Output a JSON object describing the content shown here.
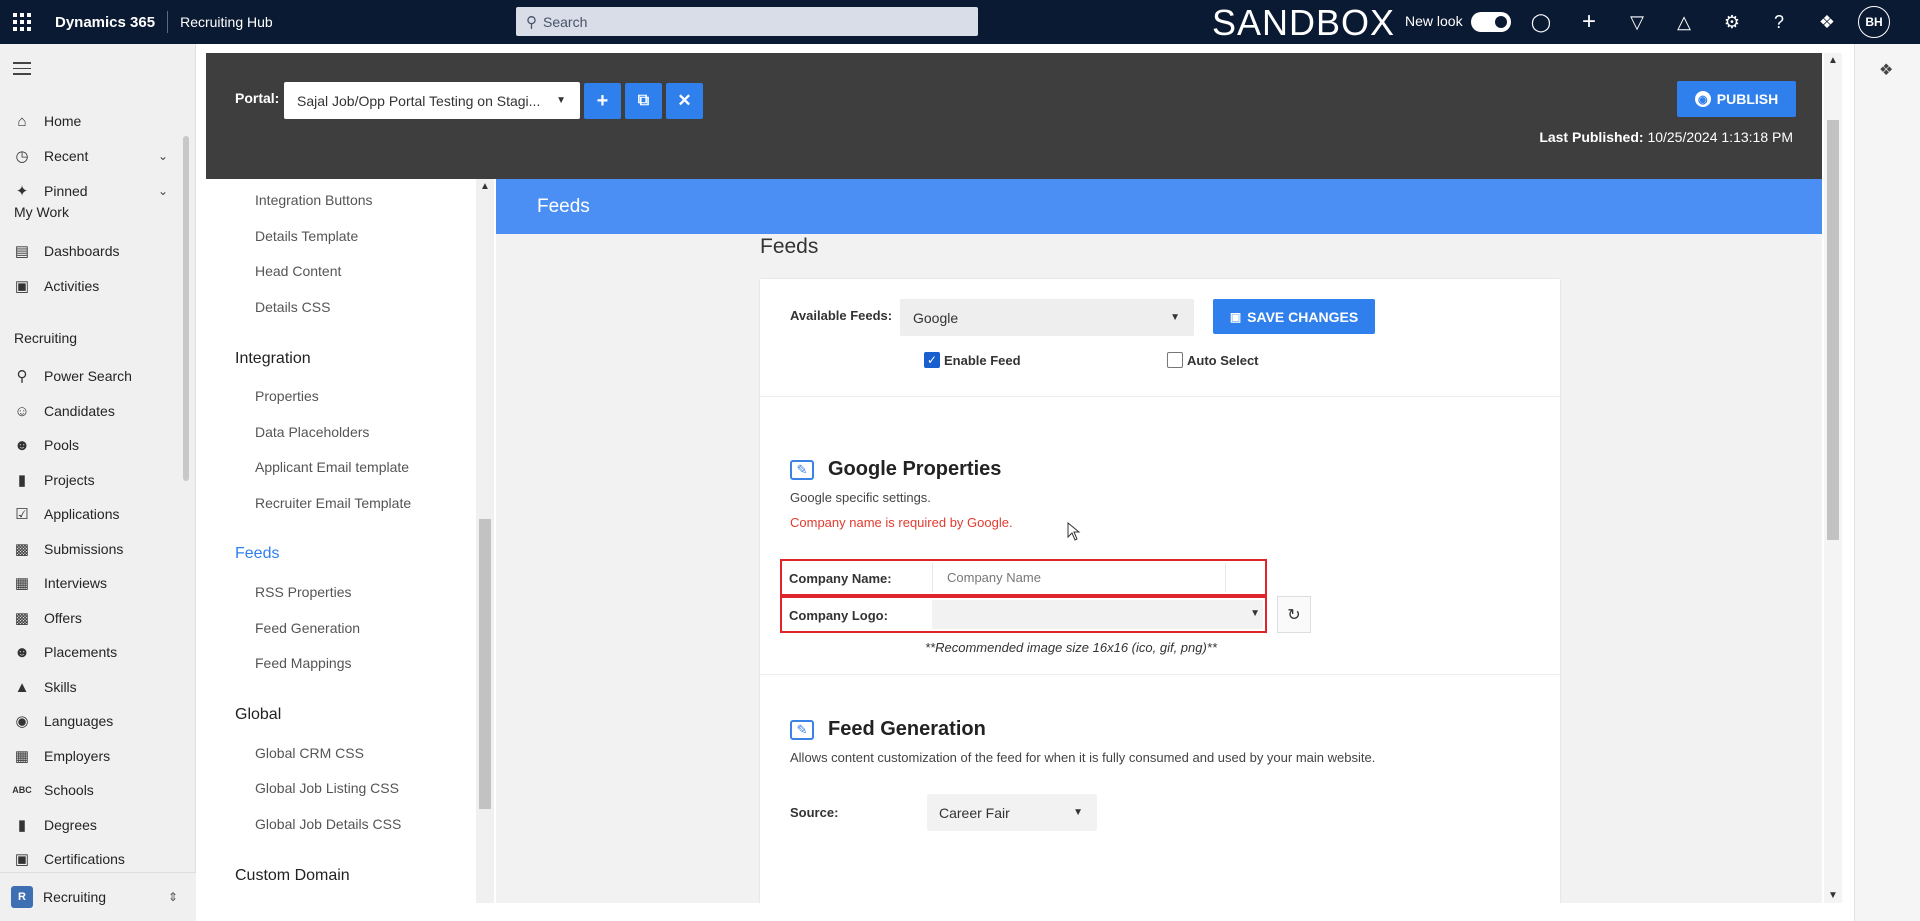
{
  "topbar": {
    "brand": "Dynamics 365",
    "app": "Recruiting Hub",
    "search_placeholder": "Search",
    "environment": "SANDBOX",
    "new_look_label": "New look",
    "new_look_on": true,
    "user_initials": "BH"
  },
  "nav": {
    "home": "Home",
    "recent": "Recent",
    "pinned": "Pinned",
    "my_work": "My Work",
    "dashboards": "Dashboards",
    "activities": "Activities",
    "recruiting": "Recruiting",
    "items": [
      "Power Search",
      "Candidates",
      "Pools",
      "Projects",
      "Applications",
      "Submissions",
      "Interviews",
      "Offers",
      "Placements",
      "Skills",
      "Languages",
      "Employers",
      "Schools",
      "Degrees",
      "Certifications"
    ],
    "area_badge": "R",
    "area_name": "Recruiting"
  },
  "portal": {
    "label": "Portal:",
    "selected": "Sajal Job/Opp Portal Testing on Stagi...",
    "publish_label": "PUBLISH",
    "last_published_label": "Last Published:",
    "last_published_value": "10/25/2024 1:13:18 PM"
  },
  "tree": {
    "top_items": [
      "Integration Buttons",
      "Details Template",
      "Head Content",
      "Details CSS"
    ],
    "integration": "Integration",
    "integration_items": [
      "Properties",
      "Data Placeholders",
      "Applicant Email template",
      "Recruiter Email Template"
    ],
    "feeds": "Feeds",
    "feeds_items": [
      "RSS Properties",
      "Feed Generation",
      "Feed Mappings"
    ],
    "global": "Global",
    "global_items": [
      "Global CRM CSS",
      "Global Job Listing CSS",
      "Global Job Details CSS"
    ],
    "custom_domain": "Custom Domain"
  },
  "content": {
    "banner": "Feeds",
    "title": "Feeds",
    "available_feeds_label": "Available Feeds:",
    "available_feeds_value": "Google",
    "save_label": "SAVE CHANGES",
    "enable_feed_label": "Enable Feed",
    "enable_feed_checked": true,
    "auto_select_label": "Auto Select",
    "auto_select_checked": false,
    "google": {
      "title": "Google Properties",
      "desc": "Google specific settings.",
      "error": "Company name is required by Google.",
      "company_name_label": "Company Name:",
      "company_name_placeholder": "Company Name",
      "company_logo_label": "Company Logo:",
      "hint": "**Recommended image size 16x16 (ico, gif, png)**"
    },
    "feed_generation": {
      "title": "Feed Generation",
      "desc": "Allows content customization of the feed for when it is fully consumed and used by your main website.",
      "source_label": "Source:",
      "source_value": "Career Fair"
    }
  },
  "colors": {
    "topbar": "#0b1a33",
    "accent": "#2f80ed",
    "banner": "#4b8ff5",
    "error": "#e03b2e"
  }
}
